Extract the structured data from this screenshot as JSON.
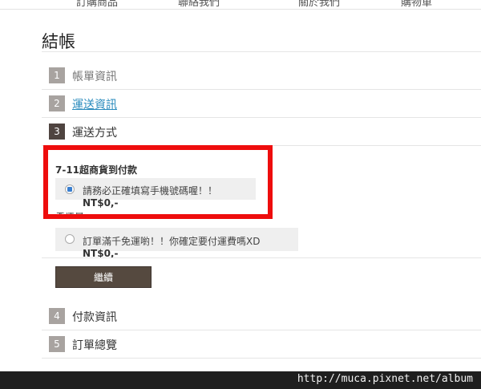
{
  "top_nav": [
    "訂購商品",
    "聯絡我們",
    "關於我們",
    "購物車"
  ],
  "page": {
    "title": "結帳"
  },
  "steps": [
    {
      "num": "1",
      "label": "帳單資訊"
    },
    {
      "num": "2",
      "label": "運送資訊"
    },
    {
      "num": "3",
      "label": "運送方式"
    },
    {
      "num": "4",
      "label": "付款資訊"
    },
    {
      "num": "5",
      "label": "訂單總覽"
    }
  ],
  "shipping": {
    "method_title": "7-11超商貨到付款",
    "option1": {
      "text": "請務必正確填寫手機號碼喔！！",
      "price": "NT$0,-",
      "selected": true
    },
    "partial_label": "免運費",
    "option2": {
      "text": "訂單滿千免運喲！！你確定要付運費嗎XD",
      "price": "NT$0,-",
      "selected": false
    },
    "continue_label": "繼續"
  },
  "footer": {
    "watermark": "http://muca.pixnet.net/album"
  },
  "colors": {
    "highlight": "#ee0d0d",
    "link": "#2a8bbd",
    "button": "#55493f"
  }
}
